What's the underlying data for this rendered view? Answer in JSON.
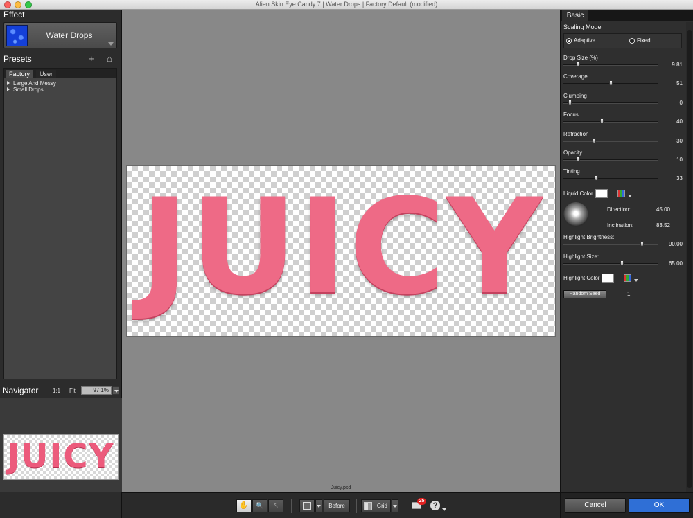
{
  "window": {
    "title": "Alien Skin Eye Candy 7 | Water Drops | Factory Default (modified)",
    "traffic_colors": [
      "#fc615d",
      "#fdbc40",
      "#34c84a"
    ]
  },
  "left_panel": {
    "effect": {
      "title": "Effect",
      "name": "Water Drops"
    },
    "presets": {
      "title": "Presets",
      "add_icon": "+",
      "home_icon": "⌂",
      "tabs": [
        {
          "label": "Factory"
        },
        {
          "label": "User"
        }
      ],
      "items": [
        {
          "label": "Large And Messy"
        },
        {
          "label": "Small Drops"
        }
      ]
    },
    "navigator": {
      "title": "Navigator",
      "one_to_one": "1:1",
      "fit": "Fit",
      "zoom": "97.1%",
      "thumb_text": "JUICY"
    }
  },
  "canvas": {
    "doc_text": "JUICY",
    "file_name": "Juicy.psd",
    "text_color": "#ee6a86"
  },
  "toolbar": {
    "hand_icon": "✋",
    "zoom_icon": "🔍",
    "pointer_icon": "↖",
    "before_label": "Before",
    "grid_label": "Grid",
    "notification_count": "25",
    "help_icon": "?"
  },
  "right_panel": {
    "tab": "Basic",
    "scaling_mode": {
      "title": "Scaling Mode",
      "options": [
        "Adaptive",
        "Fixed"
      ],
      "selected": "Adaptive"
    },
    "sliders": [
      {
        "label": "Drop Size (%)",
        "value": "9.81",
        "fraction": 0.1
      },
      {
        "label": "Coverage",
        "value": "51",
        "fraction": 0.51
      },
      {
        "label": "Clumping",
        "value": "0",
        "fraction": 0.0
      },
      {
        "label": "Focus",
        "value": "40",
        "fraction": 0.4
      },
      {
        "label": "Refraction",
        "value": "30",
        "fraction": 0.3
      },
      {
        "label": "Opacity",
        "value": "10",
        "fraction": 0.1
      },
      {
        "label": "Tinting",
        "value": "33",
        "fraction": 0.33
      }
    ],
    "liquid_color": {
      "label": "Liquid Color",
      "color": "#ffffff"
    },
    "direction": {
      "label": "Direction:",
      "value": "45.00"
    },
    "inclination": {
      "label": "Inclination:",
      "value": "83.52"
    },
    "highlight_brightness": {
      "label": "Highlight Brightness:",
      "value": "90.00",
      "fraction": 0.9
    },
    "highlight_size": {
      "label": "Highlight Size:",
      "value": "65.00",
      "fraction": 0.65
    },
    "highlight_color": {
      "label": "Highlight Color",
      "color": "#ffffff"
    },
    "random_seed": {
      "label": "Random Seed",
      "value": "1"
    },
    "cancel_label": "Cancel",
    "ok_label": "OK",
    "ok_color": "#2f6fd6"
  }
}
